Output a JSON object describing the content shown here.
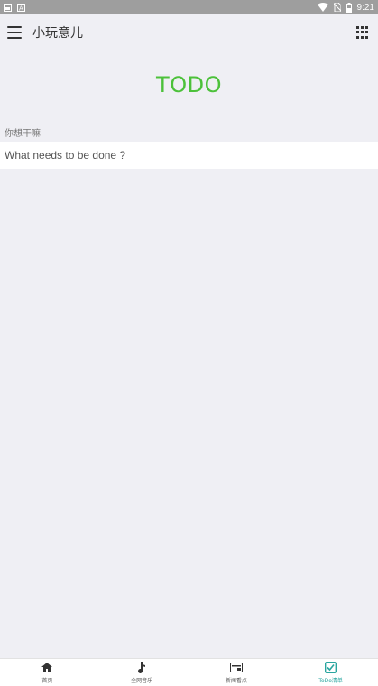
{
  "status_bar": {
    "time": "9:21",
    "icons": [
      "notification-icon",
      "notification-icon",
      "wifi-icon",
      "no-sim-icon",
      "battery-icon"
    ]
  },
  "header": {
    "title": "小玩意儿",
    "menu_icon": "menu-icon",
    "grid_icon": "apps-grid-icon"
  },
  "main": {
    "heading": "TODO",
    "field_label": "你想干嘛",
    "input": {
      "value": "",
      "placeholder": "What needs to be done ?"
    }
  },
  "tabs": [
    {
      "label": "首页",
      "icon": "home-icon",
      "active": false
    },
    {
      "label": "全网音乐",
      "icon": "music-note-icon",
      "active": false
    },
    {
      "label": "新闻看点",
      "icon": "news-icon",
      "active": false
    },
    {
      "label": "ToDo清单",
      "icon": "checkbox-icon",
      "active": true
    }
  ],
  "colors": {
    "accent_heading": "#4cc13a",
    "active_tab": "#2aa6a0",
    "background": "#efeff4",
    "status_bar": "#9e9e9e"
  }
}
